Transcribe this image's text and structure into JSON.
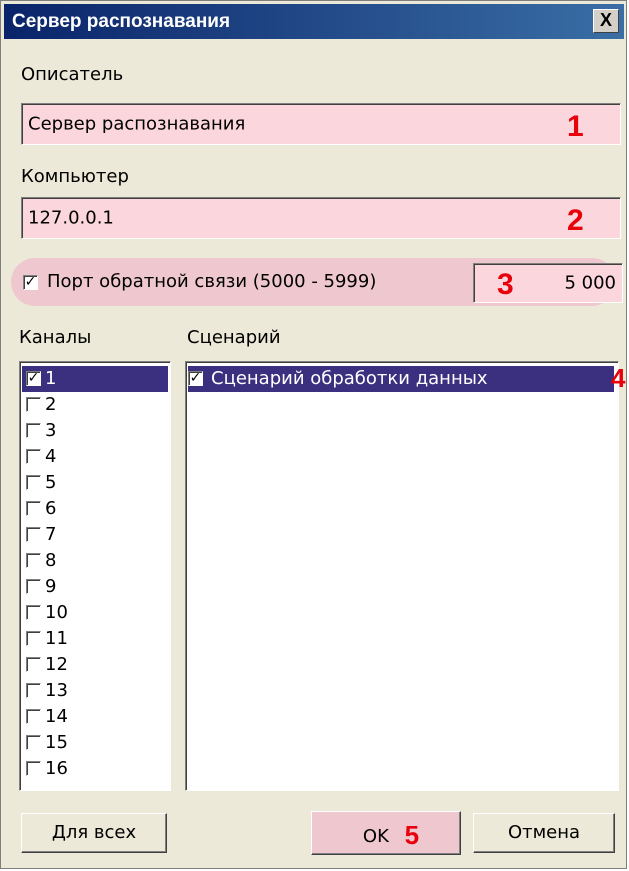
{
  "window": {
    "title": "Сервер распознавания",
    "close_label": "X"
  },
  "descriptor": {
    "label": "Описатель",
    "value": "Сервер распознавания",
    "marker": "1"
  },
  "computer": {
    "label": "Компьютер",
    "value": "127.0.0.1",
    "marker": "2"
  },
  "port": {
    "checked_glyph": "✓",
    "label": "Порт обратной связи (5000 - 5999)",
    "value": "5 000",
    "marker": "3"
  },
  "channels": {
    "label": "Каналы",
    "items": [
      {
        "label": "1",
        "checked": "✓"
      },
      {
        "label": "2",
        "checked": ""
      },
      {
        "label": "3",
        "checked": ""
      },
      {
        "label": "4",
        "checked": ""
      },
      {
        "label": "5",
        "checked": ""
      },
      {
        "label": "6",
        "checked": ""
      },
      {
        "label": "7",
        "checked": ""
      },
      {
        "label": "8",
        "checked": ""
      },
      {
        "label": "9",
        "checked": ""
      },
      {
        "label": "10",
        "checked": ""
      },
      {
        "label": "11",
        "checked": ""
      },
      {
        "label": "12",
        "checked": ""
      },
      {
        "label": "13",
        "checked": ""
      },
      {
        "label": "14",
        "checked": ""
      },
      {
        "label": "15",
        "checked": ""
      },
      {
        "label": "16",
        "checked": ""
      }
    ]
  },
  "scenario": {
    "label": "Сценарий",
    "items": [
      {
        "label": "Сценарий обработки данных",
        "checked": "✓"
      }
    ],
    "marker": "4"
  },
  "buttons": {
    "for_all": "Для всех",
    "ok": "OK",
    "ok_marker": "5",
    "cancel": "Отмена"
  },
  "colors": {
    "highlight": "#fbd6dd",
    "marker": "#e8000a",
    "selection": "#3b2f7f"
  }
}
